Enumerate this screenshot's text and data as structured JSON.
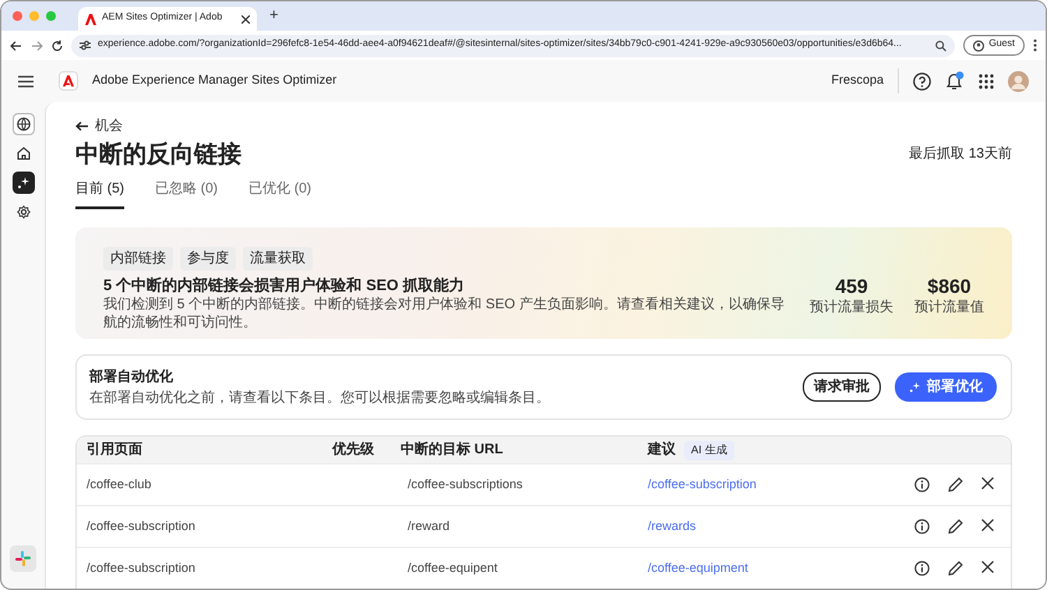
{
  "browser": {
    "tab_title": "AEM Sites Optimizer | Adob",
    "new_tab": "+",
    "url": "experience.adobe.com/?organizationId=296fefc8-1e54-46dd-aee4-a0f94621deaf#/@sitesinternal/sites-optimizer/sites/34bb79c0-c901-4241-929e-a9c930560e03/opportunities/e3d6b64...",
    "profile": "Guest"
  },
  "app": {
    "title": "Adobe Experience Manager Sites Optimizer",
    "org": "Frescopa"
  },
  "sidebar": {
    "items": [
      {
        "selected": false
      },
      {
        "selected": false
      },
      {
        "selected": true
      },
      {
        "selected": false
      }
    ]
  },
  "page": {
    "back": "机会",
    "title": "中断的反向链接",
    "last_crawl": "最后抓取 13天前"
  },
  "tabs": [
    {
      "label": "目前 (5)",
      "selected": true
    },
    {
      "label": "已忽略 (0)",
      "selected": false
    },
    {
      "label": "已优化 (0)",
      "selected": false
    }
  ],
  "summary": {
    "tags": [
      "内部链接",
      "参与度",
      "流量获取"
    ],
    "headline": "5 个中断的内部链接会损害用户体验和 SEO 抓取能力",
    "description": "我们检测到 5 个中断的内部链接。中断的链接会对用户体验和 SEO 产生负面影响。请查看相关建议，以确保导航的流畅性和可访问性。",
    "metrics": [
      {
        "value": "459",
        "label": "预计流量损失"
      },
      {
        "value": "$860",
        "label": "预计流量值"
      }
    ]
  },
  "deploy": {
    "title": "部署自动优化",
    "description": "在部署自动优化之前，请查看以下条目。您可以根据需要忽略或编辑条目。",
    "buttons": [
      {
        "label": "请求审批",
        "kind": "outline"
      },
      {
        "label": "部署优化",
        "kind": "primary"
      }
    ]
  },
  "table": {
    "columns": [
      "引用页面",
      "优先级",
      "中断的目标 URL",
      "建议"
    ],
    "ai_badge": "AI 生成",
    "rows": [
      {
        "referring_page": "/coffee-club",
        "broken_url": "/coffee-subscriptions",
        "suggestion": "/coffee-subscription"
      },
      {
        "referring_page": "/coffee-subscription",
        "broken_url": "/reward",
        "suggestion": "/rewards"
      },
      {
        "referring_page": "/coffee-subscription",
        "broken_url": "/coffee-equipent",
        "suggestion": "/coffee-equipment"
      }
    ]
  }
}
